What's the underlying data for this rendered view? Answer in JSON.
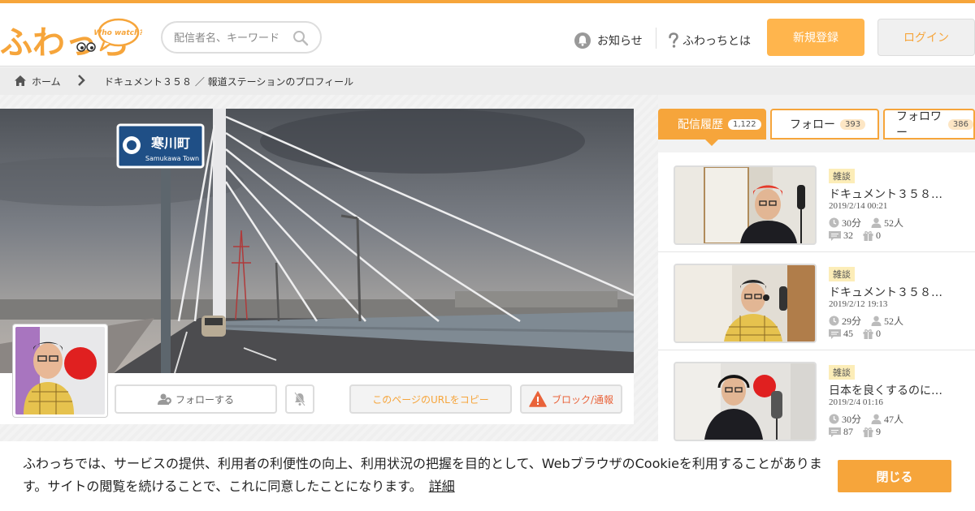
{
  "header": {
    "logo_text": "ふわっち",
    "logo_sub": "Who watch?",
    "search_placeholder": "配信者名、キーワード",
    "news_label": "お知らせ",
    "about_label": "ふわっちとは",
    "register_label": "新規登録",
    "login_label": "ログイン"
  },
  "breadcrumb": {
    "home": "ホーム",
    "current": "ドキュメント３５８ ／ 報道ステーションのプロフィール"
  },
  "cover": {
    "sign_text": "寒川町",
    "sign_sub": "Samukawa Town"
  },
  "profile": {
    "follow_label": "フォローする",
    "copy_label": "このページのURLをコピー",
    "block_label": "ブロック/通報"
  },
  "tabs": [
    {
      "label": "配信履歴",
      "count": "1,122"
    },
    {
      "label": "フォロー",
      "count": "393"
    },
    {
      "label": "フォロワー",
      "count": "386"
    }
  ],
  "broadcasts": [
    {
      "tag": "雑談",
      "title": "ドキュメント３５８…",
      "date": "2019/2/14 00:21",
      "duration": "30分",
      "viewers": "52人",
      "comments": "32",
      "gifts": "0"
    },
    {
      "tag": "雑談",
      "title": "ドキュメント３５８…",
      "date": "2019/2/12 19:13",
      "duration": "29分",
      "viewers": "52人",
      "comments": "45",
      "gifts": "0"
    },
    {
      "tag": "雑談",
      "title": "日本を良くするのに…",
      "date": "2019/2/4 01:16",
      "duration": "30分",
      "viewers": "47人",
      "comments": "87",
      "gifts": "9"
    }
  ],
  "cookie": {
    "text": "ふわっちでは、サービスの提供、利用者の利便性の向上、利用状況の把握を目的として、Webブラウザの​Cookieを利用することがあります。サイトの閲覧を続けることで、これに同意したことになります。",
    "link": "詳細",
    "close_label": "閉じる"
  },
  "colors": {
    "accent": "#f6a53b",
    "accent_light": "#ffb54d",
    "danger": "#e9633a"
  }
}
